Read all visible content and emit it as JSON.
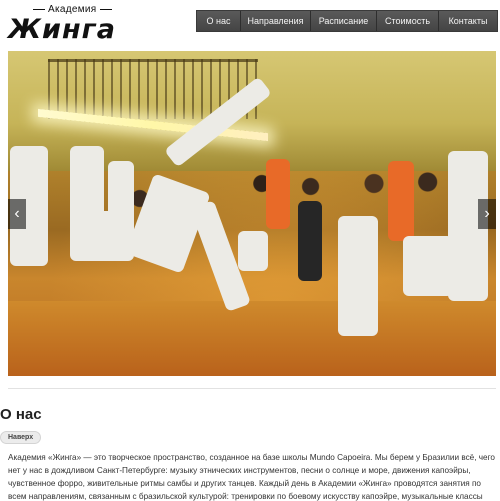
{
  "logo": {
    "top_text": "Академия",
    "main_text": "Жинга"
  },
  "nav": {
    "items": [
      {
        "label": "О нас"
      },
      {
        "label": "Направления"
      },
      {
        "label": "Расписание"
      },
      {
        "label": "Стоимость"
      },
      {
        "label": "Контакты"
      }
    ]
  },
  "hero": {
    "prev_icon": "chevron-left-icon",
    "next_icon": "chevron-right-icon",
    "prev_glyph": "‹",
    "next_glyph": "›"
  },
  "about": {
    "title": "О нас",
    "tag": "Наверх",
    "text": "Академия «Жинга» — это творческое пространство, созданное на базе школы Mundo Capoeira. Мы берем у Бразилии всё, чего нет у нас в дождливом Санкт-Петербурге: музыку этнических инструментов, песни о солнце и море, движения капоэйры, чувственное форро, живительные ритмы самбы и других танцев. Каждый день в Академии «Жинга» проводятся занятия по всем направлениям, связанным с бразильской культурой: тренировки по боевому искусству капоэйре, музыкальные классы"
  },
  "colors": {
    "nav_bg": "#4b4b4b",
    "nav_text": "#f2f2f2",
    "text": "#333333"
  }
}
